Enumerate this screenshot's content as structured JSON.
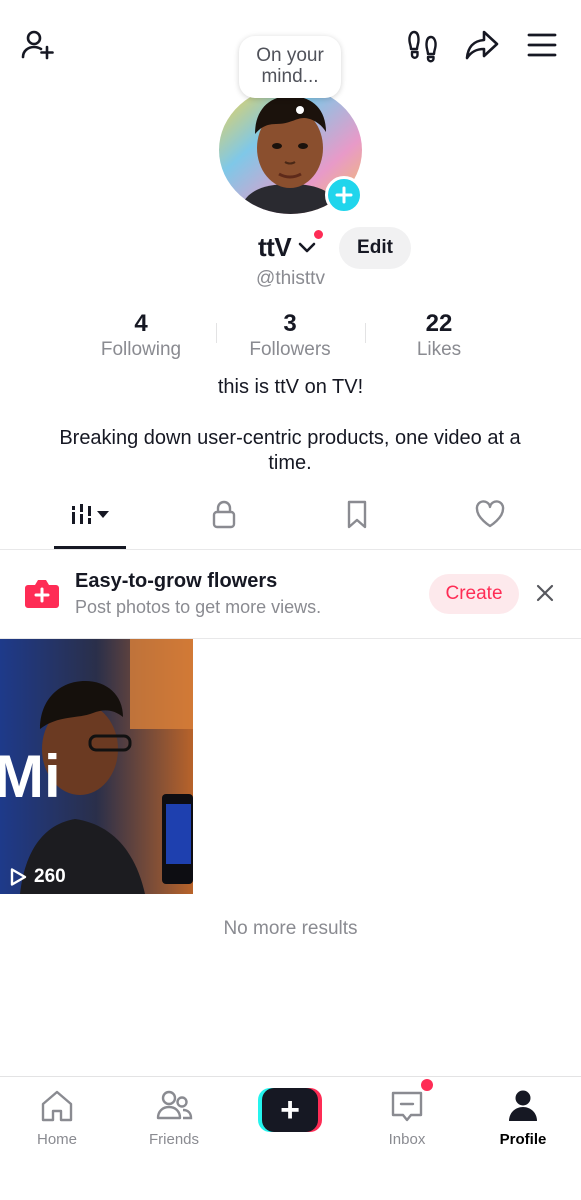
{
  "top_bar": {
    "add_friend_icon": "add-person-icon",
    "footprints_icon": "footprints-icon",
    "share_icon": "share-arrow-icon",
    "menu_icon": "hamburger-menu-icon"
  },
  "profile": {
    "bubble_text": "On your mind...",
    "username": "ttV",
    "handle": "@thisttv",
    "edit_label": "Edit",
    "stats": [
      {
        "value": "4",
        "label": "Following"
      },
      {
        "value": "3",
        "label": "Followers"
      },
      {
        "value": "22",
        "label": "Likes"
      }
    ],
    "bio_line1": "this is ttV on TV!",
    "bio_line2": "Breaking down user-centric products, one video at a time."
  },
  "tabs": [
    {
      "name": "videos",
      "icon": "grid-bars-icon",
      "active": true
    },
    {
      "name": "private",
      "icon": "lock-icon"
    },
    {
      "name": "favorites",
      "icon": "bookmark-icon"
    },
    {
      "name": "liked",
      "icon": "heart-icon"
    }
  ],
  "promo": {
    "title": "Easy-to-grow flowers",
    "subtitle": "Post photos to get more views.",
    "create_label": "Create"
  },
  "videos": [
    {
      "views": "260",
      "overlay_text": "Mi"
    }
  ],
  "no_more": "No more results",
  "nav": {
    "items": [
      {
        "label": "Home",
        "icon": "home-icon"
      },
      {
        "label": "Friends",
        "icon": "friends-icon"
      },
      {
        "label": "",
        "icon": "plus-icon"
      },
      {
        "label": "Inbox",
        "icon": "inbox-icon"
      },
      {
        "label": "Profile",
        "icon": "profile-icon",
        "active": true
      }
    ]
  },
  "colors": {
    "accent": "#fe2c55",
    "cyan": "#25f4ee",
    "text": "#161823",
    "muted": "#8a8b91"
  }
}
